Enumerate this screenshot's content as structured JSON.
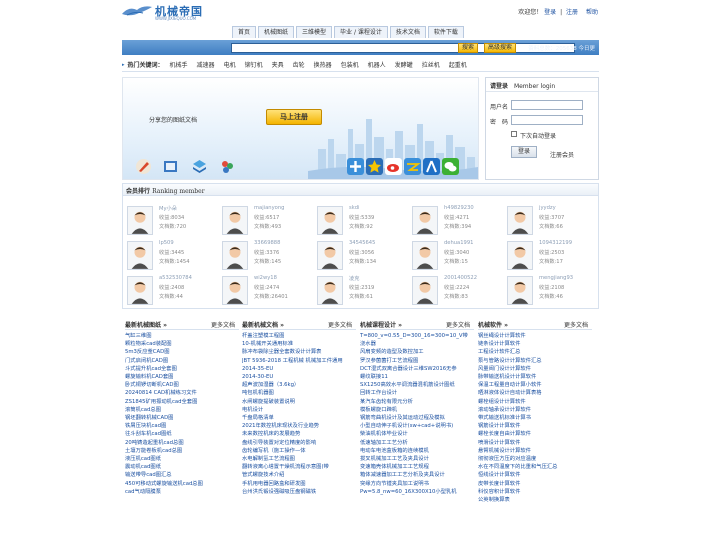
{
  "header": {
    "brand": "机械帝国",
    "url": "WWW.JIXIEQUO.COM",
    "welcome": "欢迎您！",
    "login": "登录",
    "register": "注册",
    "help": "帮助",
    "sep": "|"
  },
  "nav": [
    "首页",
    "机械图纸",
    "三维模型",
    "毕业 / 课程设计",
    "技术文档",
    "软件下载"
  ],
  "search": {
    "btn_search": "搜索",
    "btn_adv": "高级搜索",
    "stat": "资料总数：205638  今日更"
  },
  "hot": {
    "title": "热门关键词：",
    "items": [
      "机械手",
      "减速器",
      "电机",
      "铆钉机",
      "夹具",
      "齿轮",
      "换热器",
      "包装机",
      "机器人",
      "发酵罐",
      "拉丝机",
      "起重机"
    ]
  },
  "hero": {
    "tagline": "分享您的图纸文档",
    "register": "马上注册"
  },
  "login": {
    "title": "请登录",
    "sub": "Member login",
    "user": "用户名",
    "pass": "密　码",
    "remember": "下次自动登录",
    "submit": "登录",
    "member": "注册会员"
  },
  "rank": {
    "title": "会员排行",
    "sub": "Ranking member",
    "members": [
      {
        "name": "My小朵",
        "score": "收益:8034",
        "docs": "文档数:720"
      },
      {
        "name": "majianyong",
        "score": "收益:6517",
        "docs": "文档数:493"
      },
      {
        "name": "skdi",
        "score": "收益:5339",
        "docs": "文档数:92"
      },
      {
        "name": "h49829230",
        "score": "收益:4271",
        "docs": "文档数:394"
      },
      {
        "name": "jyydzy",
        "score": "收益:3707",
        "docs": "文档数:66"
      },
      {
        "name": "lp509",
        "score": "收益:3445",
        "docs": "文档数:1454"
      },
      {
        "name": "33669888",
        "score": "收益:3376",
        "docs": "文档数:145"
      },
      {
        "name": "34545645",
        "score": "收益:3056",
        "docs": "文档数:134"
      },
      {
        "name": "dehua1991",
        "score": "收益:3040",
        "docs": "文档数:15"
      },
      {
        "name": "1094312199",
        "score": "收益:2503",
        "docs": "文档数:17"
      },
      {
        "name": "a532530784",
        "score": "收益:2408",
        "docs": "文档数:44"
      },
      {
        "name": "wi2wy18",
        "score": "收益:2474",
        "docs": "文档数:26401"
      },
      {
        "name": "凌克",
        "score": "收益:2319",
        "docs": "文档数:61"
      },
      {
        "name": "2001400522",
        "score": "收益:2224",
        "docs": "文档数:83"
      },
      {
        "name": "mengjiang93",
        "score": "收益:2108",
        "docs": "文档数:46"
      }
    ]
  },
  "columns": [
    {
      "title": "最新机械图纸 »",
      "more": "更多文档",
      "items": [
        "气缸三维图",
        "颗粒物采cad装配图",
        "5m3反应釜CAD图",
        "门式启闭机CAD图",
        "斗式提升机cad全套图",
        "螺旋输料机CAD套图",
        "卧式铜锣切断机CAD图",
        "20240814 CAD机械练习文件",
        "ZS1845矿用振动机cad全套图",
        "滚筒机cad总图",
        "钢坯翻转机械CAD图",
        "铁屑压块机cad图",
        "往斗刮车机cad图纸",
        "20吨铸造起重机cad总图",
        "土壤万能卷板机cad总图",
        "液压机cad图纸",
        "震动机cad图纸",
        "输送带导cad图汇总",
        "450可移动式螺旋输送机cad总图",
        "cad气动隔膜泵"
      ]
    },
    {
      "title": "最新机械文档 »",
      "more": "更多文档",
      "items": [
        "杆盖注塑模工程图",
        "10-机械开关通用标准",
        "脉冲布袋除尘器全套数设计计算表",
        "JBT 5936-2018 工程机械 机械加工件通用",
        "2014-35-EU",
        "2014-30-EU",
        "超声波加湿器（3.6kg）",
        "吨包机机器图",
        "水闸螺旋提破装置说明",
        "电机设计",
        "千盘局格清单",
        "2021年数控机床现状及行业趋势",
        "未来数控机床的发展趋势",
        "盘线引导装置对定位精度的影响",
        "齿轮编写机（施工操作—体",
        "水电解制氢工艺流程图",
        "翻转液离心塔置干燥机流程示意图(带",
        "管式螺旋技术介绍",
        "手机用电器回路盒和研发图",
        "台州洪氏锻设强磁吸压盘钢磁铁"
      ]
    },
    {
      "title": "机械课程设计 »",
      "more": "更多文档",
      "items": [
        "T=800_v=0.55_D=300_16=300=10_V带",
        "浇水器",
        "风扇变频的造型及数控加工",
        "罗汉参菌菌打工艺流程图",
        "DCT湿式双离合器设计三维SW2016无参",
        "螺纹联接11",
        "SX1250高效水平调流器混机筋设计图纸",
        "回转工作台设计",
        "某汽车齿轮有限元分析",
        "模板螺旋口蹄机",
        "钢筋弯曲机设计及其运动过程及模拟",
        "小型自动伸子机设计(sw+cad+说明书)",
        "柴油机机体毕业设计",
        "低速轴加工工艺分析",
        "电动车电池盒板箱的连续模机",
        "拔叉机械加工工艺及夹具设计",
        "变速箱壳体机械加工工艺规程",
        "箱体减速器加工工艺分析及夹具设计",
        "突缘方向节镗夹具加工说明书",
        "Pw=5.8_nw=60_16X300X10小型乳机"
      ]
    },
    {
      "title": "机械软件 »",
      "more": "更多文档",
      "items": [
        "钢丝绳设计计算软件",
        "链条设计计算软件",
        "工程设计软件汇总",
        "泵与管路设计计算软件汇总",
        "风量阀门设计计算软件",
        "脉带输送机设计计算软件",
        "保温工程量自动计算小软件",
        "晒淋液体设计自动计算表格",
        "螺栓组设计计算软件",
        "滚动轴承设计计算软件",
        "带式输送机标准计算书",
        "钢筋设计计算软件",
        "螺栓长度自由计算软件",
        "喷滑设计计算软件",
        "悬臂机械设计计算软件",
        "彻彻液压方压的对应温度",
        "水在不同温度下的比重和气压汇总",
        "恒线设计计算软件",
        "皮带长度计算软件",
        "科仪容积计算软件",
        "公英制换算表"
      ]
    }
  ],
  "colors": {
    "accent": "#3f7ec2",
    "link": "#1a4fa0",
    "button": "#f5b800"
  }
}
